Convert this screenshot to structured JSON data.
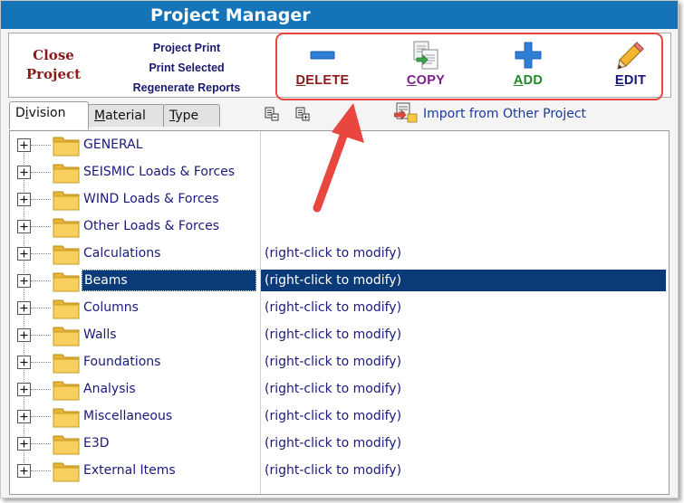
{
  "window": {
    "title": "Project Manager"
  },
  "toolbar": {
    "close_line1": "Close",
    "close_line2": "Project",
    "print_project": "Project Print",
    "print_selected": "Print Selected",
    "regenerate_reports": "Regenerate Reports",
    "delete_label": {
      "first": "D",
      "rest": "ELETE"
    },
    "copy_label": {
      "first": "C",
      "rest": "OPY"
    },
    "add_label": {
      "first": "A",
      "rest": "DD"
    },
    "edit_label": {
      "first": "E",
      "rest": "DIT"
    }
  },
  "tabs": [
    {
      "pre": "D",
      "ul": "i",
      "post": "vision"
    },
    {
      "pre": "",
      "ul": "M",
      "post": "aterial"
    },
    {
      "pre": "",
      "ul": "T",
      "post": "ype"
    }
  ],
  "import_link": "Import from Other Project",
  "tree": {
    "rows": [
      {
        "name": "GENERAL",
        "desc": ""
      },
      {
        "name": "SEISMIC Loads & Forces",
        "desc": ""
      },
      {
        "name": "WIND Loads & Forces",
        "desc": ""
      },
      {
        "name": "Other Loads & Forces",
        "desc": ""
      },
      {
        "name": "Calculations",
        "desc": "(right-click to modify)"
      },
      {
        "name": "Beams",
        "desc": "(right-click to modify)"
      },
      {
        "name": "Columns",
        "desc": "(right-click to modify)"
      },
      {
        "name": "Walls",
        "desc": "(right-click to modify)"
      },
      {
        "name": "Foundations",
        "desc": "(right-click to modify)"
      },
      {
        "name": "Analysis",
        "desc": "(right-click to modify)"
      },
      {
        "name": "Miscellaneous",
        "desc": "(right-click to modify)"
      },
      {
        "name": "E3D",
        "desc": "(right-click to modify)"
      },
      {
        "name": "External Items",
        "desc": "(right-click to modify)"
      }
    ],
    "selected_index": 5
  },
  "colors": {
    "title_bar": "#1573b8",
    "selection": "#0b3a78",
    "highlight_border": "#e8473f",
    "folder": "#f7c948"
  },
  "icons": {
    "delete": "minus-icon",
    "copy": "copy-pages-icon",
    "add": "plus-icon",
    "edit": "pencil-icon",
    "expander": "plus-box-icon",
    "folder": "folder-icon"
  }
}
